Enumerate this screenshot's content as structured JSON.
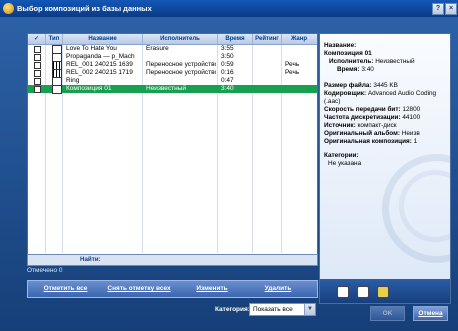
{
  "window": {
    "title": "Выбор композиций из базы данных",
    "help_label": "?",
    "close_label": "×"
  },
  "table": {
    "headers": [
      "✓",
      "Тип",
      "Название",
      "Исполнитель",
      "Время",
      "Рейтинг",
      "Жанр"
    ],
    "rows": [
      {
        "name": "Love To Hate You",
        "artist": "Erasure",
        "time": "3:55",
        "genre": "",
        "type": "audio"
      },
      {
        "name": "Propaganda — p_Mach",
        "artist": "",
        "time": "3:50",
        "genre": "",
        "type": "audio"
      },
      {
        "name": "REL_001 240215 1639",
        "artist": "Переносное устройство",
        "time": "0:59",
        "genre": "Речь",
        "type": "film"
      },
      {
        "name": "REL_002 240215 1719",
        "artist": "Переносное устройство",
        "time": "0:16",
        "genre": "Речь",
        "type": "film"
      },
      {
        "name": "Ring",
        "artist": "",
        "time": "0:47",
        "genre": "",
        "type": "audio"
      },
      {
        "name": "Композиция 01",
        "artist": "Неизвестный",
        "time": "3:40",
        "genre": "",
        "type": "audio"
      }
    ]
  },
  "find_label": "Найти:",
  "marked_text": "Отмечено 0",
  "buttons": {
    "select_all": "Отметить все",
    "clear_all": "Снять отметку всех",
    "edit": "Изменить",
    "delete": "Удалить",
    "ok": "OK",
    "cancel": "Отмена"
  },
  "category": {
    "label": "Категория:",
    "value": "Показать все"
  },
  "details": {
    "name_label": "Название:",
    "name_value": "Композиция 01",
    "artist_label": "Исполнитель:",
    "artist_value": "Неизвестный",
    "time_label": "Время:",
    "time_value": "3:40",
    "size_label": "Размер файла:",
    "size_value": "3445 KB",
    "codec_label": "Кодировщик:",
    "codec_value": "Advanced Audio Coding (.aac)",
    "bitrate_label": "Скорость передачи бит:",
    "bitrate_value": "12800",
    "sample_label": "Частота дискретизации:",
    "sample_value": "44100",
    "source_label": "Источник:",
    "source_value": "компакт-диск",
    "orig_album_label": "Оригинальный альбом:",
    "orig_album_value": "Неизв",
    "orig_track_label": "Оригинальная композиция:",
    "orig_track_value": "1",
    "categories_label": "Категории:",
    "categories_value": "Не указана"
  }
}
